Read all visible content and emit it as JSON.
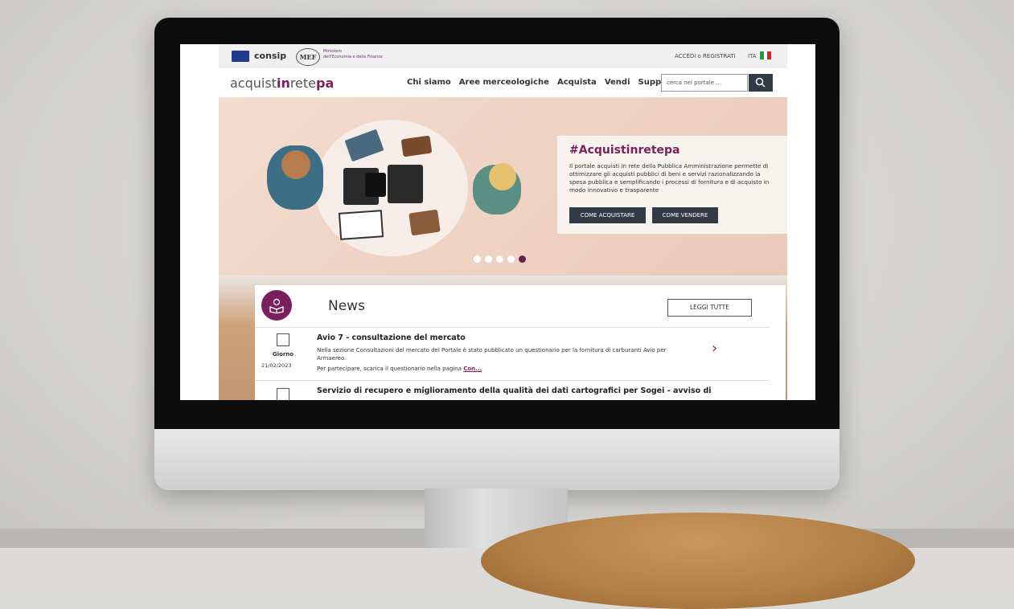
{
  "header": {
    "consip": "consip",
    "mef_logo": "MEF",
    "mef_line1": "Ministero",
    "mef_line2": "dell'Economia e delle Finanze",
    "login": "ACCEDI o REGISTRATI",
    "language": "ITA"
  },
  "brand": {
    "part1": "acquist",
    "part2": "in",
    "part3": "rete",
    "part4": "pa"
  },
  "nav": {
    "items": [
      "Chi siamo",
      "Aree merceologiche",
      "Acquista",
      "Vendi",
      "Supporto"
    ],
    "search_placeholder": "cerca nel portale ..."
  },
  "hero": {
    "title": "#Acquistinretepa",
    "text": "Il portale acquisti in rete della Pubblica Amministrazione permette di ottimizzare gli acquisti pubblici di beni e servizi razionalizzando la spesa pubblica e semplificando i processi di fornitura e di acquisto in modo innovativo e trasparente",
    "btn_buy": "COME ACQUISTARE",
    "btn_sell": "COME VENDERE",
    "active_slide": 5,
    "slide_count": 5
  },
  "news": {
    "title": "News",
    "read_all": "LEGGI TUTTE",
    "items": [
      {
        "day_label": "Giorno",
        "date": "21/02/2023",
        "title": "Avio 7 - consultazione del mercato",
        "text": "Nella sezione Consultazioni del mercato del Portale è stato pubblicato un questionario per la fornitura di carburanti Avio per Armaereo.",
        "text2": "Per partecipare, scarica il questionario nella pagina",
        "more": "Con..."
      },
      {
        "title": "Servizio di recupero e miglioramento della qualità dei dati cartografici per Sogei - avviso di"
      }
    ]
  },
  "colors": {
    "brand_purple": "#7a1f5c",
    "dark_button": "#333a45"
  }
}
